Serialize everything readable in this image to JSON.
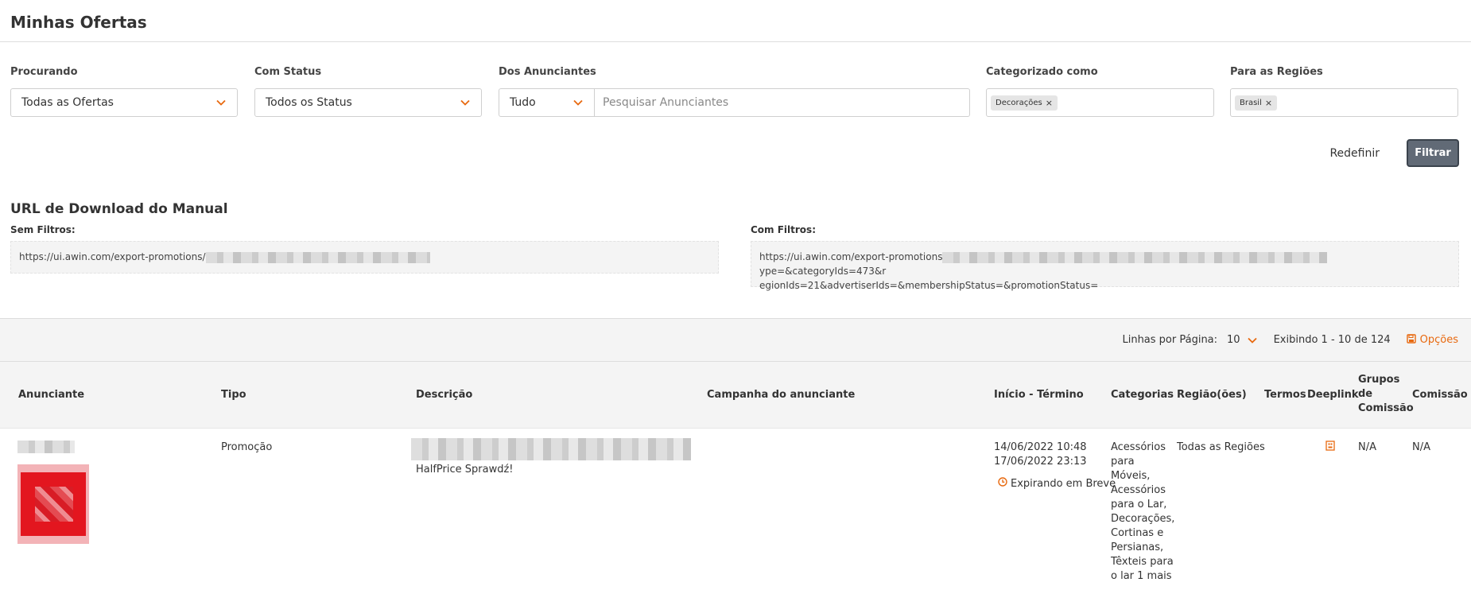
{
  "header": {
    "title": "Minhas Ofertas"
  },
  "filters": {
    "searching": {
      "label": "Procurando",
      "value": "Todas as Ofertas"
    },
    "status": {
      "label": "Com Status",
      "value": "Todos os Status"
    },
    "advertisers": {
      "label": "Dos Anunciantes",
      "scope_value": "Tudo",
      "search_placeholder": "Pesquisar Anunciantes"
    },
    "category": {
      "label": "Categorizado como",
      "tags": [
        "Decorações"
      ]
    },
    "regions": {
      "label": "Para as Regiões",
      "tags": [
        "Brasil"
      ]
    }
  },
  "actions": {
    "reset_label": "Redefinir",
    "filter_label": "Filtrar"
  },
  "manual": {
    "title": "URL de Download do Manual",
    "no_filters": {
      "label": "Sem Filtros:",
      "url_prefix": "https://ui.awin.com/export-promotions/"
    },
    "with_filters": {
      "label": "Com Filtros:",
      "url_prefix": "https://ui.awin.com/export-promotions",
      "url_suffix_line1": "ype=&categoryIds=473&r",
      "url_line2": "egionIds=21&advertiserIds=&membershipStatus=&promotionStatus="
    }
  },
  "toolbar": {
    "rows_label": "Linhas por Página:",
    "rows_value": "10",
    "showing": "Exibindo 1 - 10 de 124",
    "options_label": "Opções"
  },
  "table": {
    "columns": {
      "advertiser": "Anunciante",
      "type": "Tipo",
      "description": "Descrição",
      "campaign": "Campanha do anunciante",
      "period": "Início - Término",
      "categories": "Categorias",
      "regions": "Região(ões)",
      "terms": "Termos",
      "deeplink": "Deeplink",
      "commission_groups_1": "Grupos",
      "commission_groups_2": "de",
      "commission_groups_3": "Comissão",
      "commission": "Comissão"
    },
    "rows": [
      {
        "type": "Promoção",
        "description_text": "HalfPrice Sprawdź!",
        "start": "14/06/2022 10:48",
        "end": "17/06/2022 23:13",
        "status": "Expirando em Breve",
        "categories_lines": [
          "Acessórios",
          "para",
          "Móveis,",
          "Acessórios",
          "para o Lar,",
          "Decorações,",
          "Cortinas e",
          "Persianas,",
          "Têxteis para",
          "o lar 1 mais"
        ],
        "regions": "Todas as Regiões",
        "commission_groups": "N/A",
        "commission": "N/A"
      }
    ]
  },
  "colors": {
    "accent": "#e8690f",
    "button_dark": "#616a76",
    "logo_red": "#e3161f"
  }
}
